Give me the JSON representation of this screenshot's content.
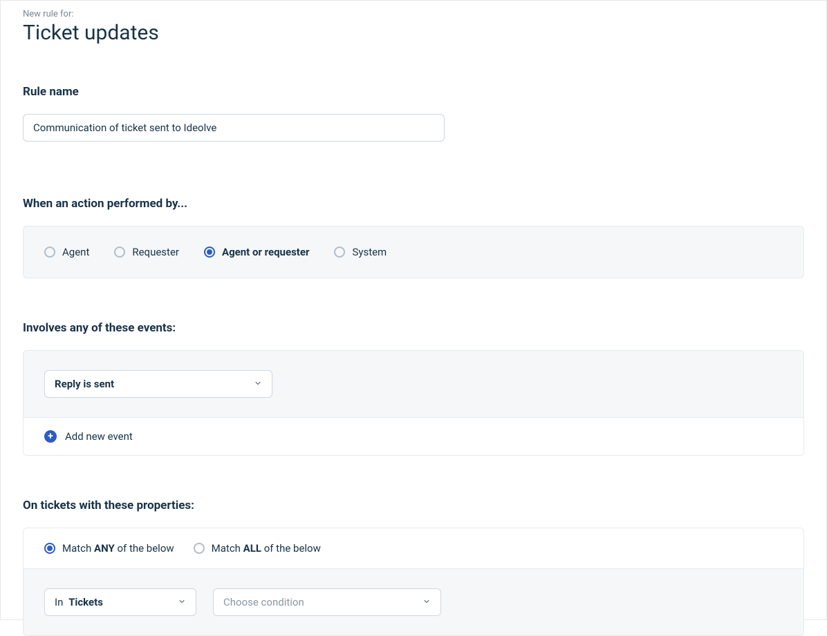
{
  "header": {
    "eyebrow": "New rule for:",
    "title": "Ticket updates"
  },
  "ruleName": {
    "label": "Rule name",
    "value": "Communication of ticket sent to Ideolve"
  },
  "action": {
    "label": "When an action performed by...",
    "options": [
      "Agent",
      "Requester",
      "Agent or requester",
      "System"
    ],
    "selectedIndex": 2
  },
  "events": {
    "label": "Involves any of these events:",
    "selected": "Reply is sent",
    "addLabel": "Add new event"
  },
  "properties": {
    "label": "On tickets with these properties:",
    "match": {
      "options": [
        {
          "pre": "Match ",
          "bold": "ANY",
          "post": " of the below"
        },
        {
          "pre": "Match ",
          "bold": "ALL",
          "post": " of the below"
        }
      ],
      "selectedIndex": 0
    },
    "scope": {
      "prefix": "In ",
      "value": "Tickets"
    },
    "conditionPlaceholder": "Choose condition"
  }
}
